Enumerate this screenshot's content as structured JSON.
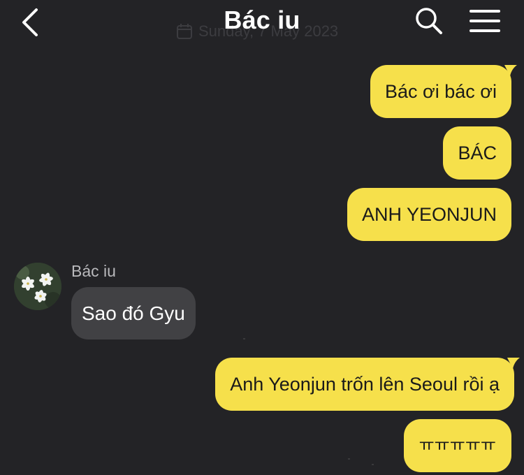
{
  "header": {
    "title": "Bác iu",
    "date": "Sunday, 7 May 2023"
  },
  "colors": {
    "background": "#232326",
    "outgoing_bubble": "#f6e04b",
    "incoming_bubble": "#414144",
    "sender_name": "#b9b9bc"
  },
  "icons": {
    "back": "chevron-left",
    "search": "magnifier",
    "menu": "hamburger",
    "calendar": "calendar"
  },
  "messages_before": [
    {
      "direction": "outgoing",
      "text": "Bác ơi bác ơi"
    },
    {
      "direction": "outgoing",
      "text": "BÁC"
    },
    {
      "direction": "outgoing",
      "text": "ANH YEONJUN"
    }
  ],
  "incoming": {
    "sender": "Bác iu",
    "text": "Sao đó Gyu"
  },
  "messages_after": [
    {
      "direction": "outgoing",
      "text": "Anh Yeonjun trốn lên Seoul rồi ạ"
    },
    {
      "direction": "outgoing",
      "text": "ㅠㅠㅠㅠㅠ"
    }
  ]
}
